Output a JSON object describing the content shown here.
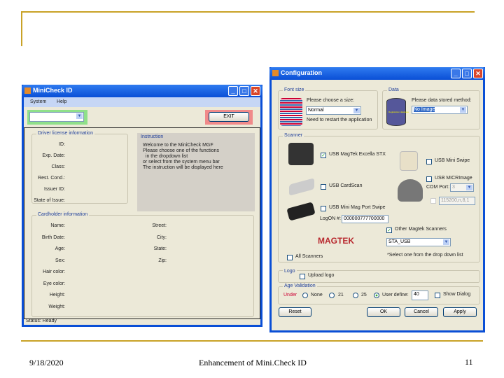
{
  "slide": {
    "date": "9/18/2020",
    "footer": "Enhancement of Mini.Check ID",
    "page": "11",
    "colors": {
      "accent": "#c9a227"
    }
  },
  "minicheck": {
    "title": "MiniCheck ID",
    "menu": [
      "System",
      "Help"
    ],
    "exit_label": "EXIT",
    "driver_group": "Driver license information",
    "driver_fields": [
      "ID:",
      "Exp. Date:",
      "Class:",
      "Rest. Cond.:",
      "Issuer ID:",
      "State of Issue:"
    ],
    "instruction_title": "Instruction",
    "instruction_lines": [
      "Welcome to the MiniCheck MGF",
      "Please choose one of the functions",
      "  in the dropdown list",
      "or select from the system menu bar",
      "The instruction will be displayed here"
    ],
    "cardholder_group": "Cardholder information",
    "cardholder_left": [
      "Name:",
      "Birth Date:",
      "Age:",
      "Sex:",
      "Hair color:",
      "Eye color:",
      "Height:",
      "Weight:"
    ],
    "cardholder_right": [
      "Street:",
      "City:",
      "State:",
      "Zip:"
    ],
    "status": "Status: Ready"
  },
  "config": {
    "title": "Configuration",
    "font_group": "Font size",
    "font_prompt": "Please choose a size:",
    "font_value": "Normal",
    "font_note": "Need to restart the application",
    "data_group": "Data",
    "data_prompt": "Please data stored method:",
    "data_value": "No Image",
    "db_label": "Registration database",
    "scanner_group": "Scanner",
    "scanners": {
      "usb_excella": "USB MagTek Excella STX",
      "usb_mini": "USB Mini Swipe",
      "usb_micr": "USB MICRImage",
      "usb_cardscan": "USB CardScan",
      "usb_minimag": "USB Mini Mag Port Swipe"
    },
    "com_port_label": "COM Port:",
    "com_port_value": "3",
    "baud_value": "115200,n,8,1",
    "logon_label": "LogON #:",
    "logon_value": "000000777700000",
    "other_label": "Other Magtek Scanners",
    "other_value": "STA_USB",
    "other_note": "*Select one from the drop down list",
    "magtek": "MAGTEK",
    "all_scanners": "All Scanners",
    "logo_group": "Logo",
    "upload_logo": "Upload logo",
    "age_group": "Age Validation",
    "age_prefix": "Under",
    "age_options": [
      "None",
      "21",
      "25",
      "User define:"
    ],
    "age_user_value": "40",
    "show_dialog": "Show Dialog",
    "buttons": {
      "reset": "Reset",
      "ok": "OK",
      "cancel": "Cancel",
      "apply": "Apply"
    }
  }
}
